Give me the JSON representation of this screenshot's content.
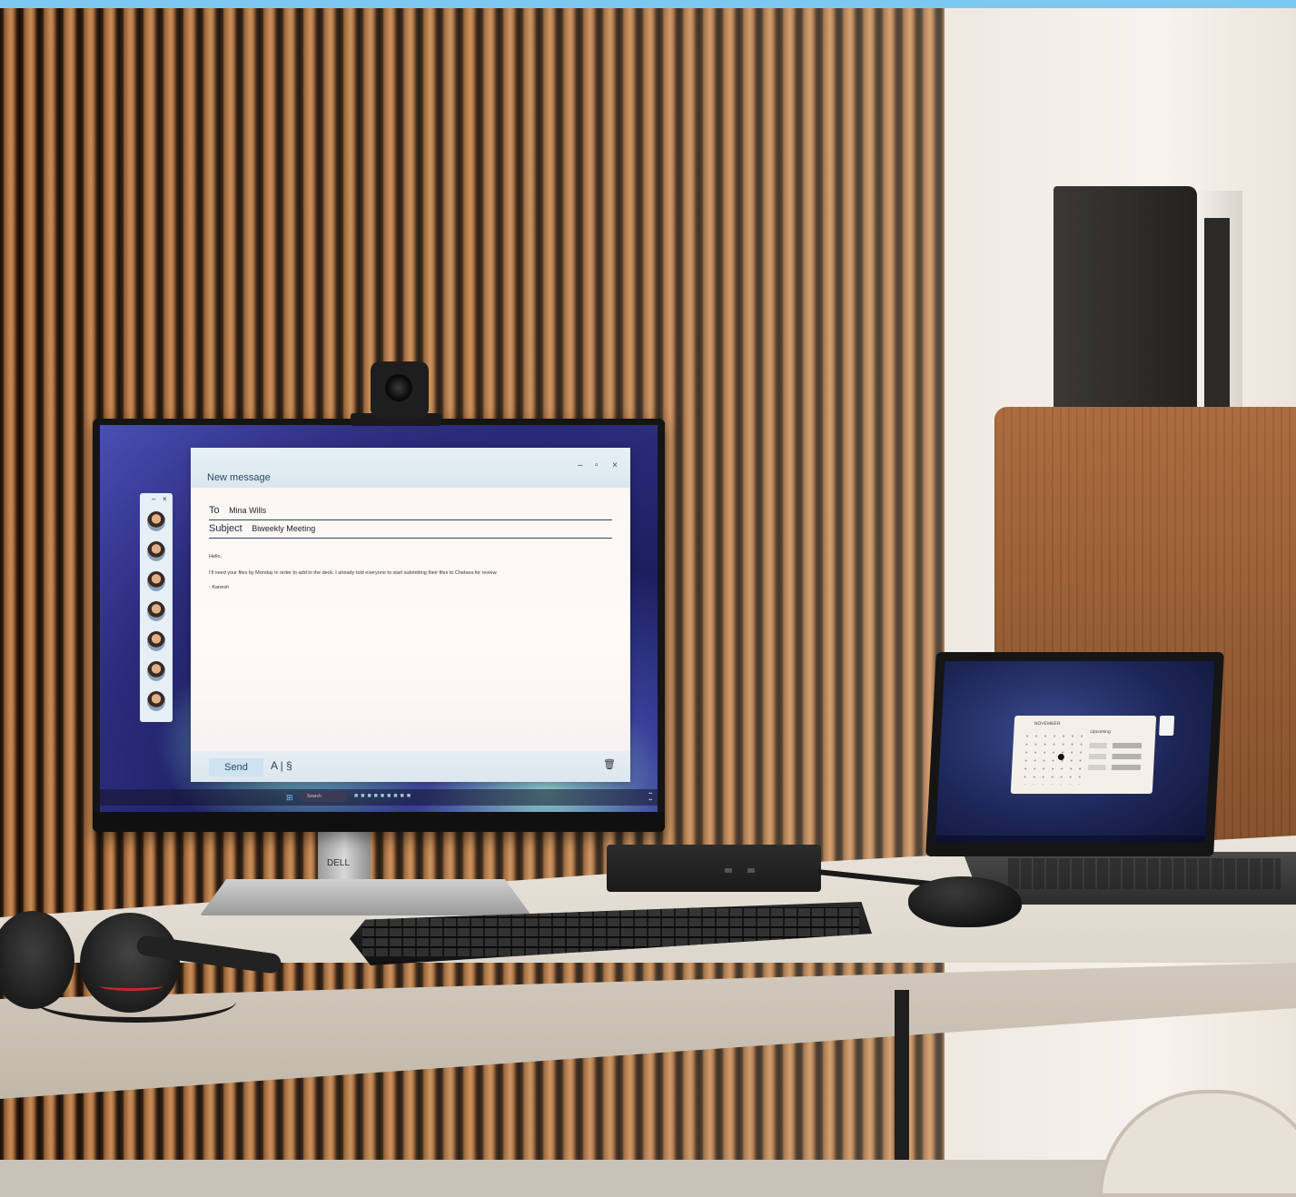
{
  "mail": {
    "title": "New message",
    "window_controls": [
      "–",
      "▫",
      "×"
    ],
    "to_label": "To",
    "to_value": "Mina Wills",
    "subject_label": "Subject",
    "subject_value": "Biweekly Meeting",
    "body_greeting": "Hello,",
    "body_text": "I'll need your files by Monday in order to add to the deck. I already told everyone to start submitting their files to Chelsea for review.",
    "signature": "- Kanesh",
    "send_label": "Send",
    "format_label": "A | §",
    "trash_icon": "trash-icon"
  },
  "contacts": {
    "controls": [
      "–",
      "×"
    ],
    "count": 7
  },
  "taskbar": {
    "search_placeholder": "Search"
  },
  "laptop": {
    "calendar_month": "NOVEMBER",
    "calendar_heading": "Upcoming"
  },
  "monitor_brand": "DELL",
  "colors": {
    "accent": "#7cc8ef",
    "send_button": "#cfe2f0",
    "headset_accent": "#c2282c"
  }
}
